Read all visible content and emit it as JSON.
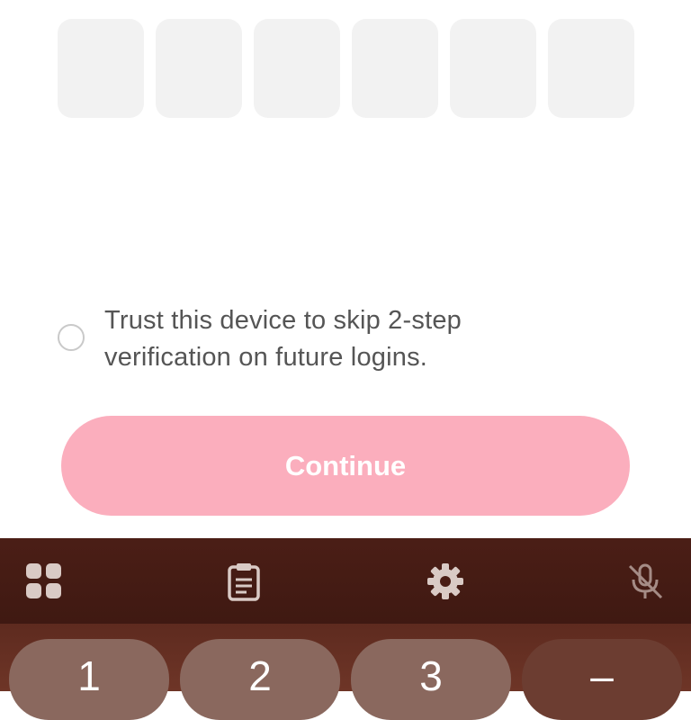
{
  "otp": {
    "digits": [
      "",
      "",
      "",
      "",
      "",
      ""
    ]
  },
  "trust_device": {
    "label": "Trust this device to skip 2-step verification on future logins.",
    "checked": false
  },
  "continue_button": {
    "label": "Continue",
    "color": "#fbaebd"
  },
  "keyboard": {
    "toolbar": [
      "apps-grid-icon",
      "clipboard-icon",
      "settings-gear-icon",
      "mic-off-icon"
    ],
    "keys": [
      "1",
      "2",
      "3",
      "–"
    ]
  }
}
